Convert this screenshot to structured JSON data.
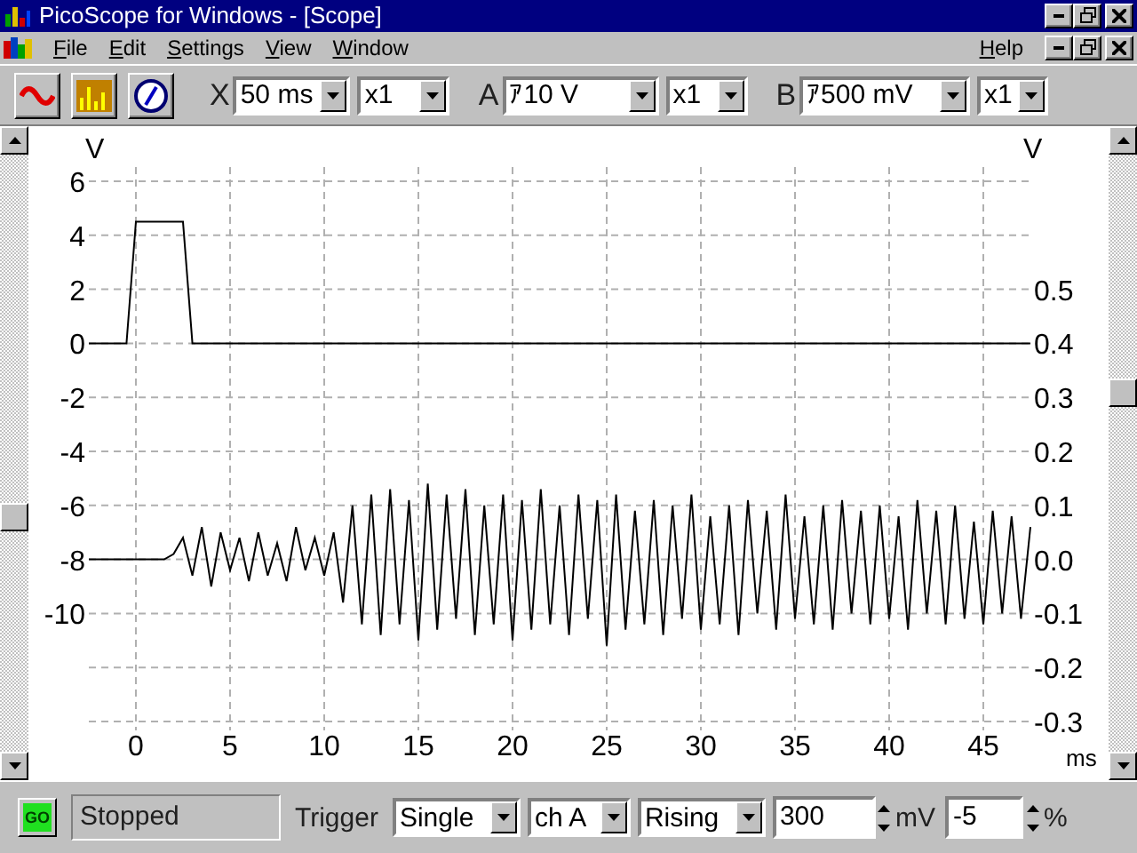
{
  "window": {
    "title": "PicoScope for Windows - [Scope]"
  },
  "menu": {
    "items": [
      "File",
      "Edit",
      "Settings",
      "View",
      "Window"
    ],
    "help": "Help"
  },
  "toolbar": {
    "timebase": {
      "label": "X",
      "value": "50 ms",
      "multiplier": "x1"
    },
    "channels": [
      {
        "label": "A",
        "range": "ｱ10 V",
        "multiplier": "x1"
      },
      {
        "label": "B",
        "range": "ｱ500 mV",
        "multiplier": "x1"
      }
    ]
  },
  "chart_data": {
    "type": "line",
    "grid": true,
    "xlabel": "ms",
    "ylabel": "V",
    "y2label": "V",
    "xlim": [
      -2.5,
      47.5
    ],
    "ylim": [
      -14,
      6
    ],
    "y2lim": [
      -0.3,
      0.7
    ],
    "xticks": [
      0,
      5,
      10,
      15,
      20,
      25,
      30,
      35,
      40,
      45
    ],
    "yticks": [
      -10,
      -8,
      -6,
      -4,
      -2,
      0,
      2,
      4,
      6
    ],
    "y2ticks": [
      {
        "value": -0.3,
        "label": "-0.3"
      },
      {
        "value": -0.2,
        "label": "-0.2"
      },
      {
        "value": -0.1,
        "label": "-0.1"
      },
      {
        "value": 0,
        "label": "0.0"
      },
      {
        "value": 0.1,
        "label": "0.1"
      },
      {
        "value": 0.2,
        "label": "0.2"
      },
      {
        "value": 0.3,
        "label": "0.3"
      },
      {
        "value": 0.4,
        "label": "0.4"
      },
      {
        "value": 0.5,
        "label": "0.5"
      }
    ],
    "x": [
      -2.5,
      -2,
      -1.5,
      -1,
      -0.5,
      0,
      0.5,
      1,
      1.5,
      2,
      2.5,
      3,
      3.5,
      4,
      4.5,
      5,
      5.5,
      6,
      6.5,
      7,
      7.5,
      8,
      8.5,
      9,
      9.5,
      10,
      10.5,
      11,
      11.5,
      12,
      12.5,
      13,
      13.5,
      14,
      14.5,
      15,
      15.5,
      16,
      16.5,
      17,
      17.5,
      18,
      18.5,
      19,
      19.5,
      20,
      20.5,
      21,
      21.5,
      22,
      22.5,
      23,
      23.5,
      24,
      24.5,
      25,
      25.5,
      26,
      26.5,
      27,
      27.5,
      28,
      28.5,
      29,
      29.5,
      30,
      30.5,
      31,
      31.5,
      32,
      32.5,
      33,
      33.5,
      34,
      34.5,
      35,
      35.5,
      36,
      36.5,
      37,
      37.5,
      38,
      38.5,
      39,
      39.5,
      40,
      40.5,
      41,
      41.5,
      42,
      42.5,
      43,
      43.5,
      44,
      44.5,
      45,
      45.5,
      46,
      46.5,
      47,
      47.5
    ],
    "series": [
      {
        "color": "#000000",
        "values": [
          0,
          0,
          0,
          0,
          0,
          4.5,
          4.5,
          4.5,
          4.5,
          4.5,
          4.5,
          0,
          0,
          0,
          0,
          0,
          0,
          0,
          0,
          0,
          0,
          0,
          0,
          0,
          0,
          0,
          0,
          0,
          0,
          0,
          0,
          0,
          0,
          0,
          0,
          0,
          0,
          0,
          0,
          0,
          0,
          0,
          0,
          0,
          0,
          0,
          0,
          0,
          0,
          0,
          0,
          0,
          0,
          0,
          0,
          0,
          0,
          0,
          0,
          0,
          0,
          0,
          0,
          0,
          0,
          0,
          0,
          0,
          0,
          0,
          0,
          0,
          0,
          0,
          0,
          0,
          0,
          0,
          0,
          0,
          0,
          0,
          0,
          0,
          0,
          0,
          0,
          0,
          0,
          0,
          0,
          0,
          0,
          0,
          0,
          0,
          0,
          0,
          0,
          0,
          0
        ]
      },
      {
        "color": "#000000",
        "axis": "y2",
        "values": [
          0,
          0,
          0,
          0,
          0,
          0,
          0,
          0,
          0,
          0.01,
          0.04,
          -0.03,
          0.06,
          -0.05,
          0.05,
          -0.02,
          0.04,
          -0.04,
          0.05,
          -0.03,
          0.03,
          -0.04,
          0.06,
          -0.02,
          0.04,
          -0.03,
          0.05,
          -0.08,
          0.1,
          -0.12,
          0.12,
          -0.14,
          0.13,
          -0.12,
          0.11,
          -0.15,
          0.14,
          -0.13,
          0.12,
          -0.11,
          0.13,
          -0.14,
          0.1,
          -0.12,
          0.12,
          -0.15,
          0.11,
          -0.13,
          0.13,
          -0.12,
          0.1,
          -0.14,
          0.12,
          -0.11,
          0.11,
          -0.16,
          0.12,
          -0.13,
          0.09,
          -0.12,
          0.11,
          -0.14,
          0.1,
          -0.11,
          0.12,
          -0.13,
          0.08,
          -0.12,
          0.1,
          -0.14,
          0.11,
          -0.1,
          0.09,
          -0.13,
          0.12,
          -0.11,
          0.08,
          -0.12,
          0.1,
          -0.13,
          0.11,
          -0.1,
          0.09,
          -0.12,
          0.1,
          -0.11,
          0.08,
          -0.13,
          0.11,
          -0.1,
          0.09,
          -0.12,
          0.1,
          -0.11,
          0.07,
          -0.12,
          0.09,
          -0.1,
          0.08,
          -0.11,
          0.06
        ]
      }
    ]
  },
  "status_bar": {
    "go": "GO",
    "status": "Stopped",
    "trigger_label": "Trigger",
    "trigger_mode": "Single",
    "trigger_channel": "ch A",
    "trigger_edge": "Rising",
    "threshold": "300",
    "threshold_unit": "mV",
    "delay": "-5",
    "delay_unit": "%"
  }
}
